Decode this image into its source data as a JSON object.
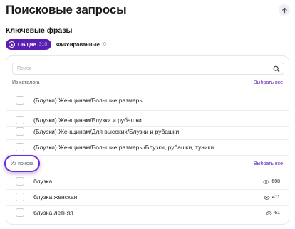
{
  "header": {
    "title": "Поисковые запросы",
    "subtitle": "Ключевые фразы"
  },
  "tabs": {
    "general": {
      "label": "Общие",
      "count": "310"
    },
    "fixed": {
      "label": "Фиксированные",
      "count": "0"
    }
  },
  "search": {
    "placeholder": "Поиск"
  },
  "catalog": {
    "label": "Из каталога",
    "select_all": "Выбрать все",
    "items": [
      "(Блузки) Женщинам/Большие размеры",
      "(Блузки) Женщинам/Блузки и рубашки",
      "(Блузки) Женщинам/Для высоких/Блузки и рубашки",
      "(Блузки) Женщинам/Большие размеры/Блузки, рубашки, туники"
    ]
  },
  "from_search": {
    "label": "Из поиска",
    "select_all": "Выбрать все",
    "items": [
      {
        "text": "блузка",
        "views": "608"
      },
      {
        "text": "блузка женская",
        "views": "411"
      },
      {
        "text": "блузка летняя",
        "views": "61"
      }
    ]
  },
  "colors": {
    "accent": "#5a1fb0",
    "border": "#e6e8ec"
  },
  "icons": {
    "scroll_top": "arrow-up-icon",
    "search": "search-icon",
    "views": "eye-icon",
    "tab": "play-circle-icon"
  }
}
